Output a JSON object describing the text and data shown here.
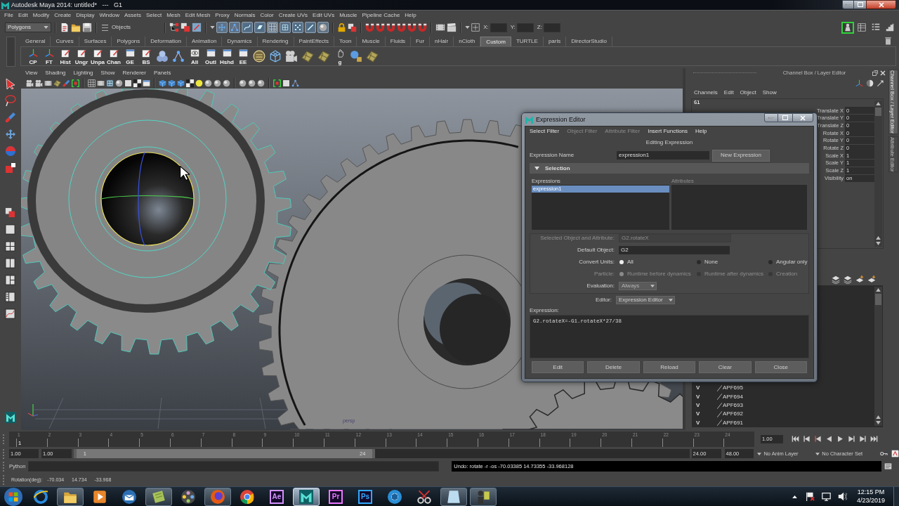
{
  "window": {
    "title": "Autodesk Maya 2014: untitled*   ---   G1"
  },
  "menu_bar": [
    "File",
    "Edit",
    "Modify",
    "Create",
    "Display",
    "Window",
    "Assets",
    "Select",
    "Mesh",
    "Edit Mesh",
    "Proxy",
    "Normals",
    "Color",
    "Create UVs",
    "Edit UVs",
    "Muscle",
    "Pipeline Cache",
    "Help"
  ],
  "status_line": {
    "menu_set": "Polygons",
    "selection_mode": "Objects",
    "mask_toggles": [
      {
        "on": true
      },
      {
        "on": true
      },
      {
        "on": true
      },
      {
        "on": true
      },
      {
        "on": true
      },
      {
        "on": true
      },
      {
        "on": true
      },
      {
        "on": true
      },
      {
        "on": true
      }
    ],
    "coordinate_fields": [
      {
        "label": "X:"
      },
      {
        "label": "Y:"
      },
      {
        "label": "Z:"
      }
    ],
    "panel_toggles": [
      {
        "on": true
      },
      {
        "on": false
      },
      {
        "on": false
      },
      {
        "on": false
      }
    ]
  },
  "shelf": {
    "tabs": [
      {
        "label": "General",
        "selected": false
      },
      {
        "label": "Curves",
        "selected": false
      },
      {
        "label": "Surfaces",
        "selected": false
      },
      {
        "label": "Polygons",
        "selected": false
      },
      {
        "label": "Deformation",
        "selected": false
      },
      {
        "label": "Animation",
        "selected": false
      },
      {
        "label": "Dynamics",
        "selected": false
      },
      {
        "label": "Rendering",
        "selected": false
      },
      {
        "label": "PaintEffects",
        "selected": false
      },
      {
        "label": "Toon",
        "selected": false
      },
      {
        "label": "Muscle",
        "selected": false
      },
      {
        "label": "Fluids",
        "selected": false
      },
      {
        "label": "Fur",
        "selected": false
      },
      {
        "label": "nHair",
        "selected": false
      },
      {
        "label": "nCloth",
        "selected": false
      },
      {
        "label": "Custom",
        "selected": true
      },
      {
        "label": "TURTLE",
        "selected": false
      },
      {
        "label": "paris",
        "selected": false
      },
      {
        "label": "DirectorStudio",
        "selected": false
      }
    ],
    "buttons": [
      {
        "kind": "labeled",
        "label": "CP"
      },
      {
        "kind": "labeled",
        "label": "FT"
      },
      {
        "kind": "labeled",
        "label": "Hist"
      },
      {
        "kind": "labeled",
        "label": "Ungr"
      },
      {
        "kind": "labeled",
        "label": "Unpa"
      },
      {
        "kind": "labeled",
        "label": "Chan"
      },
      {
        "kind": "labeled",
        "label": "GE"
      },
      {
        "kind": "labeled",
        "label": "BS"
      },
      {
        "kind": "plain"
      },
      {
        "kind": "plain"
      },
      {
        "kind": "labeled",
        "label": "All"
      },
      {
        "kind": "labeled",
        "label": "Outl"
      },
      {
        "kind": "labeled",
        "label": "Hshd"
      },
      {
        "kind": "labeled",
        "label": "EE"
      },
      {
        "kind": "plain"
      },
      {
        "kind": "plain"
      },
      {
        "kind": "plain"
      },
      {
        "kind": "plain"
      },
      {
        "kind": "plain"
      },
      {
        "kind": "labeled",
        "label": "g"
      },
      {
        "kind": "plain"
      },
      {
        "kind": "plain"
      }
    ]
  },
  "viewport": {
    "menu": [
      "View",
      "Shading",
      "Lighting",
      "Show",
      "Renderer",
      "Panels"
    ],
    "camera_label": "persp"
  },
  "channel_box": {
    "title": "Channel Box / Layer Editor",
    "menu": [
      "Channels",
      "Edit",
      "Object",
      "Show"
    ],
    "object_name": "G1",
    "channels": [
      {
        "name": "Translate X",
        "value": "0"
      },
      {
        "name": "Translate Y",
        "value": "0"
      },
      {
        "name": "Translate Z",
        "value": "0"
      },
      {
        "name": "Rotate X",
        "value": "0"
      },
      {
        "name": "Rotate Y",
        "value": "0"
      },
      {
        "name": "Rotate Z",
        "value": "0"
      },
      {
        "name": "Scale X",
        "value": "1"
      },
      {
        "name": "Scale Y",
        "value": "1"
      },
      {
        "name": "Scale Z",
        "value": "1"
      },
      {
        "name": "Visibility",
        "value": "on"
      }
    ]
  },
  "layer_editor": {
    "layers": [
      {
        "visibility": "V",
        "name": "APF695"
      },
      {
        "visibility": "V",
        "name": "APF694"
      },
      {
        "visibility": "V",
        "name": "APF693"
      },
      {
        "visibility": "V",
        "name": "APF692"
      },
      {
        "visibility": "V",
        "name": "APF691"
      }
    ]
  },
  "side_tabs": [
    {
      "label": "Channel Box / Layer Editor",
      "selected": true
    },
    {
      "label": "Attribute Editor",
      "selected": false
    }
  ],
  "expression_editor": {
    "title": "Expression Editor",
    "menu": [
      {
        "label": "Select Filter",
        "disabled": false
      },
      {
        "label": "Object Filter",
        "disabled": true
      },
      {
        "label": "Attribute Filter",
        "disabled": true
      },
      {
        "label": "Insert Functions",
        "disabled": false
      },
      {
        "label": "Help",
        "disabled": false
      }
    ],
    "heading": "Editing Expression",
    "name_label": "Expression Name",
    "name_value": "expression1",
    "new_button": "New Expression",
    "section": {
      "label": "Selection",
      "expanded": true
    },
    "lists": [
      {
        "header": "Expressions",
        "disabled": false,
        "items": [
          {
            "label": "expression1",
            "selected": true
          }
        ]
      },
      {
        "header": "Attributes",
        "disabled": true
      }
    ],
    "selected_object": {
      "label": "Selected Object and Attribute:",
      "value": "G2.rotateX",
      "disabled": true
    },
    "default_object": {
      "label": "Default Object:",
      "value": "G2"
    },
    "radio_groups": [
      {
        "label": "Convert Units:",
        "disabled": false,
        "options": [
          {
            "label": "All",
            "selected": true
          },
          {
            "label": "None",
            "selected": false
          },
          {
            "label": "Angular only",
            "selected": false
          }
        ]
      },
      {
        "label": "Particle:",
        "disabled": true,
        "options": [
          {
            "label": "Runtime before dynamics",
            "selected": true
          },
          {
            "label": "Runtime after dynamics",
            "selected": false
          },
          {
            "label": "Creation",
            "selected": false
          }
        ]
      }
    ],
    "evaluation": {
      "label": "Evaluation:",
      "value": "Always"
    },
    "editor": {
      "label": "Editor:",
      "value": "Expression Editor"
    },
    "expression_label": "Expression:",
    "expression_text": "G2.rotateX=-G1.rotateX*27/38",
    "buttons": [
      "Edit",
      "Delete",
      "Reload",
      "Clear",
      "Close"
    ]
  },
  "time_slider": {
    "frames": [
      {
        "label": "1",
        "current": true
      },
      {
        "label": "2",
        "current": false
      },
      {
        "label": "3",
        "current": false
      },
      {
        "label": "4",
        "current": false
      },
      {
        "label": "5",
        "current": false
      },
      {
        "label": "6",
        "current": false
      },
      {
        "label": "7",
        "current": false
      },
      {
        "label": "8",
        "current": false
      },
      {
        "label": "9",
        "current": false
      },
      {
        "label": "10",
        "current": false
      },
      {
        "label": "11",
        "current": false
      },
      {
        "label": "12",
        "current": false
      },
      {
        "label": "13",
        "current": false
      },
      {
        "label": "14",
        "current": false
      },
      {
        "label": "15",
        "current": false
      },
      {
        "label": "16",
        "current": false
      },
      {
        "label": "17",
        "current": false
      },
      {
        "label": "18",
        "current": false
      },
      {
        "label": "19",
        "current": false
      },
      {
        "label": "20",
        "current": false
      },
      {
        "label": "21",
        "current": false
      },
      {
        "label": "22",
        "current": false
      },
      {
        "label": "23",
        "current": false
      },
      {
        "label": "24",
        "current": false
      }
    ],
    "current_frame": "1",
    "current_time": "1.00"
  },
  "range_slider": {
    "start_time": "1.00",
    "playback_start": "1.00",
    "range_start": "1",
    "range_end": "24",
    "level": 0.49,
    "playback_end": "24.00",
    "end_time": "48.00",
    "anim_layer": "No Anim Layer",
    "character_set": "No Character Set"
  },
  "command_line": {
    "language": "Python",
    "result": "Undo: rotate -r -os -70.03385 14.73355 -33.968128"
  },
  "help_line": {
    "label": "Rotation(deg):",
    "values": [
      "-70.034",
      "14.734",
      "-33.968"
    ]
  },
  "taskbar": {
    "apps": [
      {
        "kind": "app",
        "running": false,
        "selected": false
      },
      {
        "kind": "app",
        "running": true,
        "selected": false
      },
      {
        "kind": "app",
        "running": false,
        "selected": false
      },
      {
        "kind": "app",
        "running": false,
        "selected": false
      },
      {
        "kind": "app",
        "running": true,
        "selected": false
      },
      {
        "kind": "app",
        "running": false,
        "selected": false
      },
      {
        "kind": "app",
        "running": true,
        "selected": false
      },
      {
        "kind": "app",
        "running": false,
        "selected": false
      },
      {
        "kind": "letter",
        "label": "Ae",
        "color": "#d291ff",
        "running": false,
        "selected": false
      },
      {
        "kind": "app",
        "running": true,
        "selected": true
      },
      {
        "kind": "letter",
        "label": "Pr",
        "color": "#ea77ff",
        "running": false,
        "selected": false
      },
      {
        "kind": "letter",
        "label": "Ps",
        "color": "#31a8ff",
        "running": false,
        "selected": false
      },
      {
        "kind": "app",
        "running": false,
        "selected": false
      },
      {
        "kind": "app",
        "running": false,
        "selected": false
      },
      {
        "kind": "app",
        "running": true,
        "selected": false
      },
      {
        "kind": "app",
        "running": true,
        "selected": false
      }
    ],
    "time": "12:15 PM",
    "date": "4/23/2019"
  }
}
